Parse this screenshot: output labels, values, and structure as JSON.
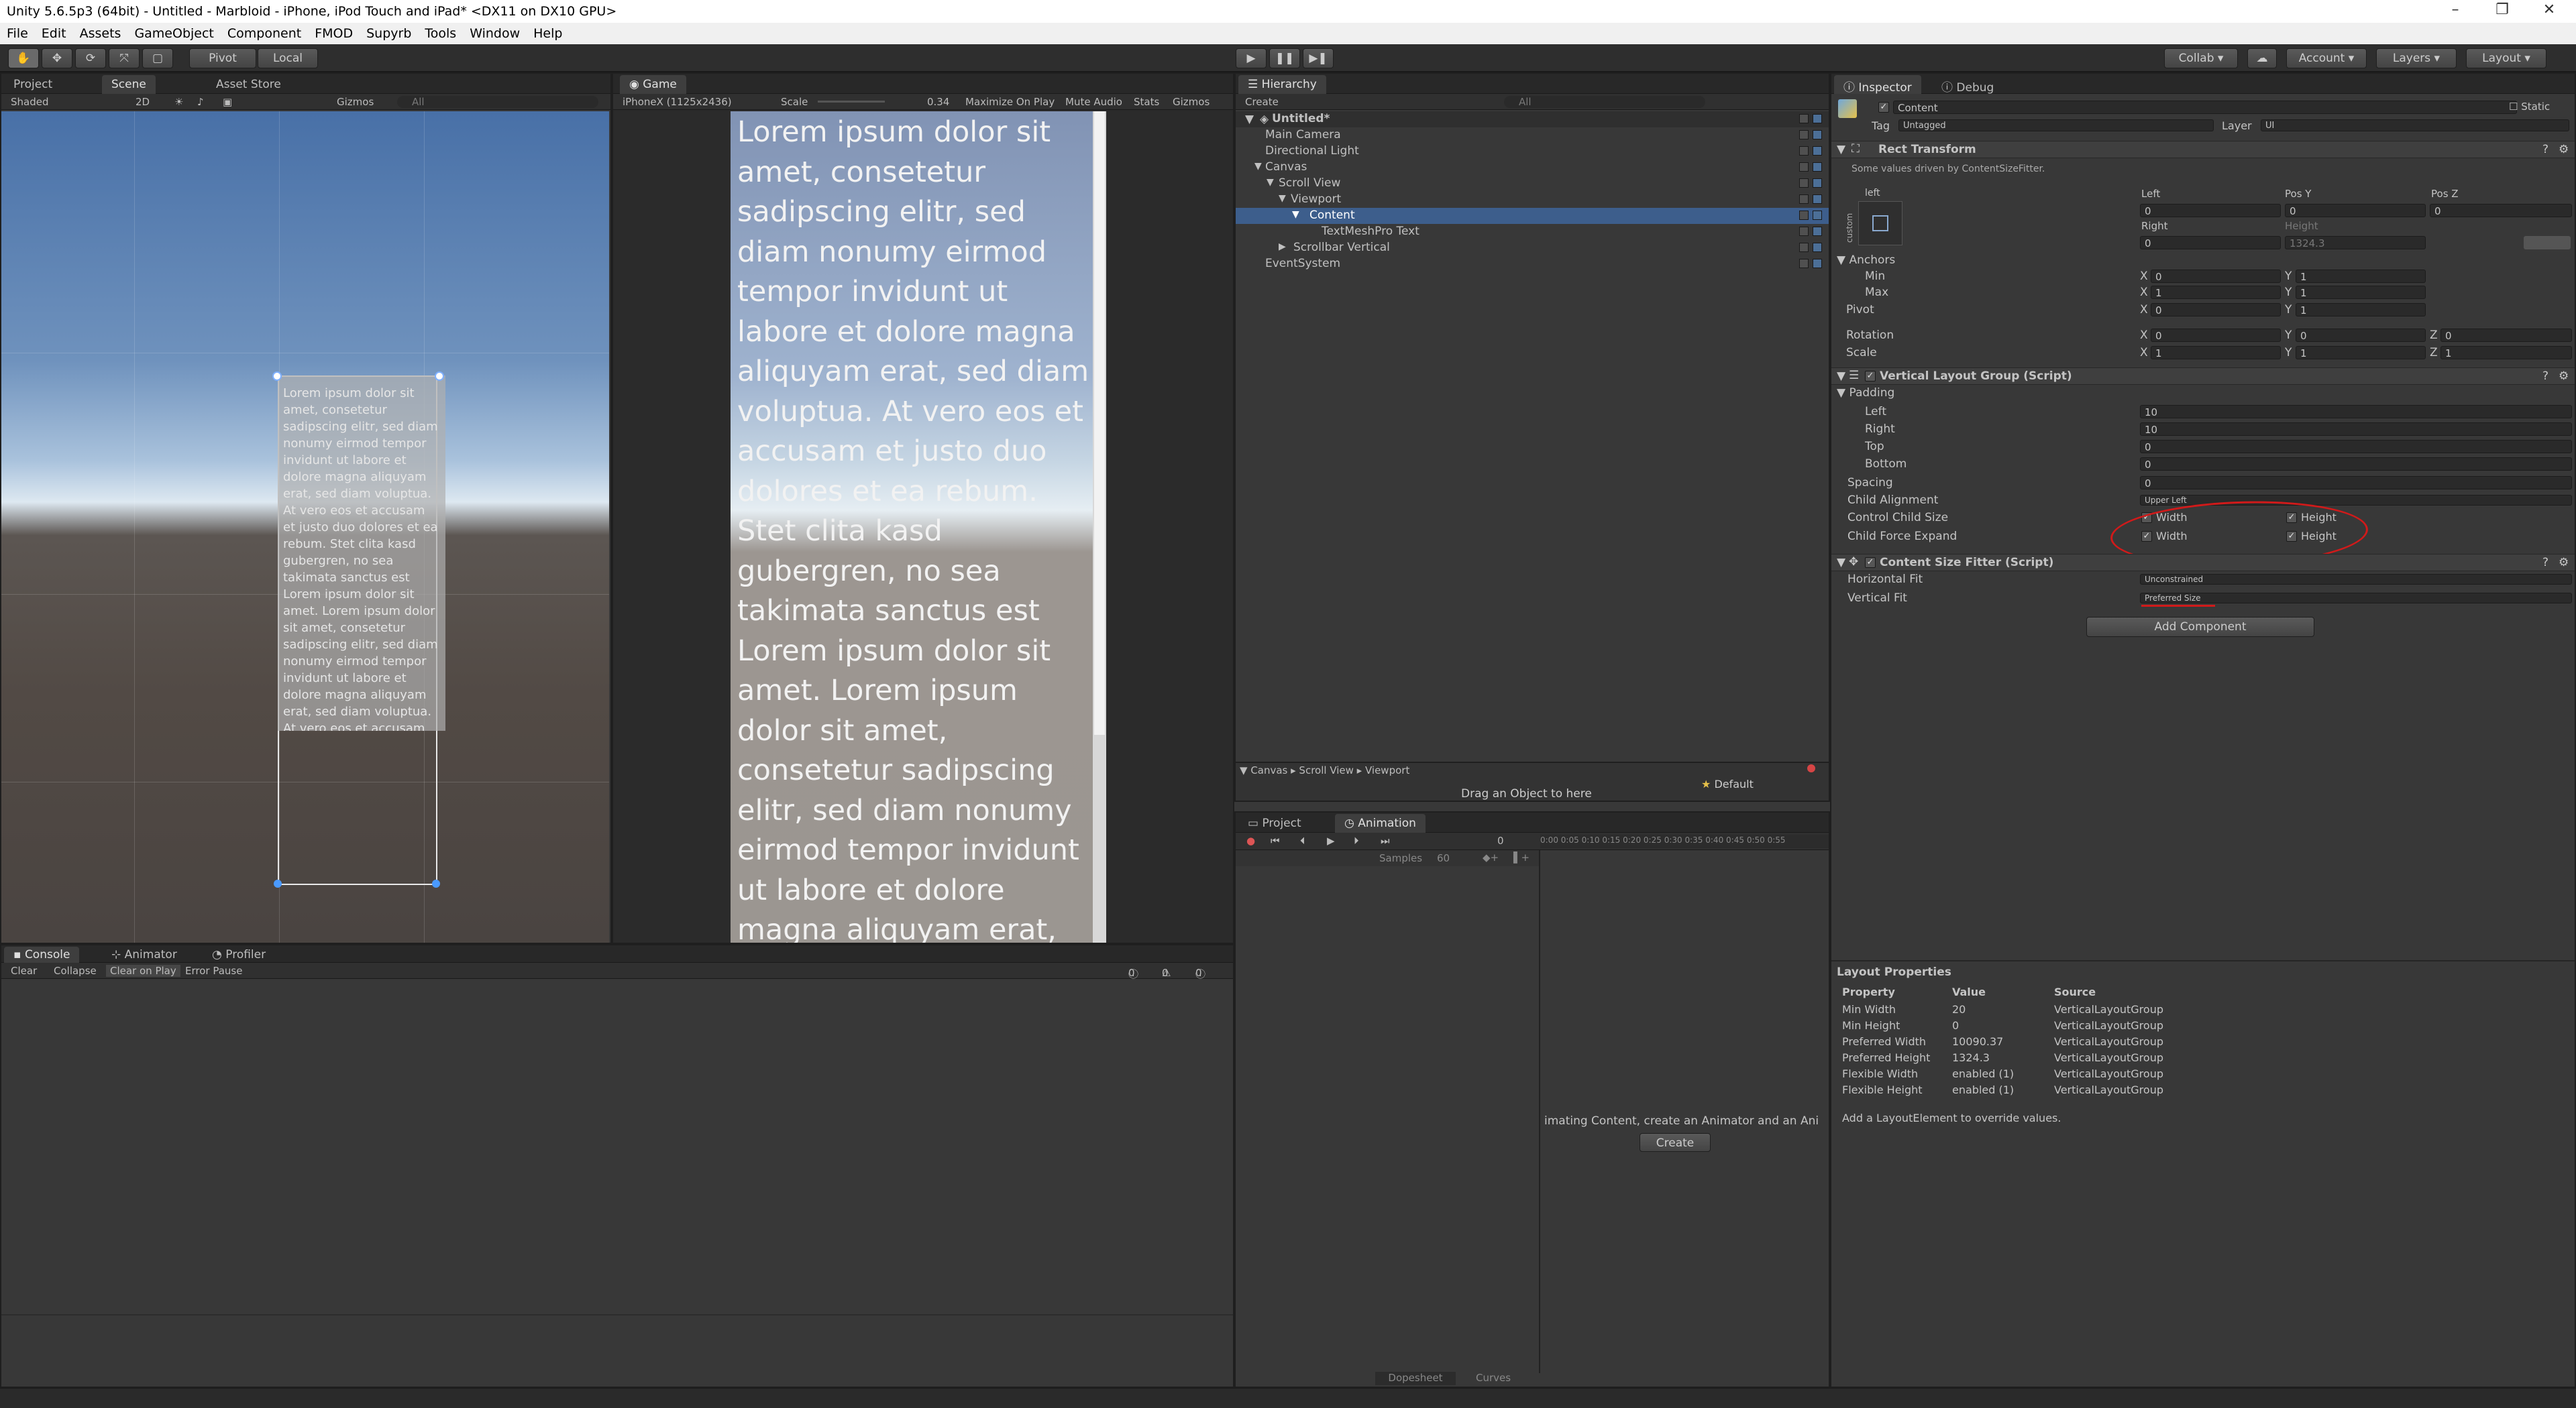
{
  "window": {
    "title": "Unity 5.6.5p3 (64bit) - Untitled - Marbloid - iPhone, iPod Touch and iPad* <DX11 on DX10 GPU>"
  },
  "menu": [
    "File",
    "Edit",
    "Assets",
    "GameObject",
    "Component",
    "FMOD",
    "Supyrb",
    "Tools",
    "Window",
    "Help"
  ],
  "toolbar": {
    "pivot": "Pivot",
    "local": "Local",
    "collab": "Collab",
    "account": "Account",
    "layers": "Layers",
    "layout": "Layout"
  },
  "scene": {
    "tabs": {
      "project": "Project",
      "scene": "Scene",
      "asset_store": "Asset Store"
    },
    "shading": "Shaded",
    "mode_2d": "2D",
    "gizmos": "Gizmos",
    "search_placeholder": "All",
    "text": "Lorem ipsum dolor sit amet, consetetur sadipscing elitr, sed diam nonumy eirmod tempor invidunt ut labore et dolore magna aliquyam erat, sed diam voluptua. At vero eos et accusam et justo duo dolores et ea rebum. Stet clita kasd gubergren, no sea takimata sanctus est Lorem ipsum dolor sit amet. Lorem ipsum dolor sit amet, consetetur sadipscing elitr, sed diam nonumy eirmod tempor invidunt ut labore et dolore magna aliquyam erat, sed diam voluptua. At vero eos et accusam et"
  },
  "game": {
    "tab": "Game",
    "resolution": "iPhoneX (1125x2436)",
    "scale_label": "Scale",
    "scale_value": "0.34",
    "maximize": "Maximize On Play",
    "mute": "Mute Audio",
    "stats": "Stats",
    "gizmos": "Gizmos",
    "text": "Lorem ipsum dolor sit amet, consetetur sadipscing elitr, sed diam nonumy eirmod tempor invidunt ut labore et dolore magna aliquyam erat, sed diam voluptua. At vero eos et accusam et justo duo dolores et ea rebum. Stet clita kasd gubergren, no sea takimata sanctus est Lorem ipsum dolor sit amet. Lorem ipsum dolor sit amet, consetetur sadipscing elitr, sed diam nonumy eirmod tempor invidunt ut labore et dolore magna aliquyam erat, sed diam voluptua. At vero eos et accusam et"
  },
  "hierarchy": {
    "tab": "Hierarchy",
    "create": "Create",
    "search_placeholder": "All",
    "scene_name": "Untitled*",
    "items": [
      "Main Camera",
      "Directional Light",
      "Canvas",
      "Scroll View",
      "Viewport",
      "Content",
      "TextMeshPro Text",
      "Scrollbar Vertical",
      "EventSystem"
    ]
  },
  "animation": {
    "breadcrumb": "Canvas ▸ Scroll View ▸ Viewport",
    "drag_hint": "Drag an Object to here",
    "default": "Default",
    "tabs": {
      "project": "Project",
      "animation": "Animation"
    },
    "samples_label": "Samples",
    "samples_value": "60",
    "frame": "0",
    "ticks": [
      "0:00",
      "0:05",
      "0:10",
      "0:15",
      "0:20",
      "0:25",
      "0:30",
      "0:35",
      "0:40",
      "0:45",
      "0:50",
      "0:55"
    ],
    "message": "imating Content, create an Animator and an Ani",
    "create": "Create",
    "dopesheet": "Dopesheet",
    "curves": "Curves"
  },
  "console": {
    "tabs": {
      "console": "Console",
      "animator": "Animator",
      "profiler": "Profiler"
    },
    "buttons": [
      "Clear",
      "Collapse",
      "Clear on Play",
      "Error Pause"
    ],
    "counts": [
      "0",
      "0",
      "0"
    ]
  },
  "inspector": {
    "tabs": {
      "inspector": "Inspector",
      "debug": "Debug"
    },
    "object_name": "Content",
    "static": "Static",
    "tag_label": "Tag",
    "tag": "Untagged",
    "layer_label": "Layer",
    "layer": "UI",
    "rect": {
      "title": "Rect Transform",
      "note": "Some values driven by ContentSizeFitter.",
      "anchor_label": "left",
      "custom": "custom",
      "col_left": "Left",
      "col_posy": "Pos Y",
      "col_posz": "Pos Z",
      "left": "0",
      "posy": "0",
      "posz": "0",
      "right_label": "Right",
      "height_label": "Height",
      "right": "0",
      "height": "1324.3",
      "anchors": "Anchors",
      "min": "Min",
      "max": "Max",
      "pivot": "Pivot",
      "rotation": "Rotation",
      "scale": "Scale",
      "min_x": "0",
      "min_y": "1",
      "max_x": "1",
      "max_y": "1",
      "pivot_x": "0",
      "pivot_y": "1",
      "rot_x": "0",
      "rot_y": "0",
      "rot_z": "0",
      "scale_x": "1",
      "scale_y": "1",
      "scale_z": "1",
      "x": "X",
      "y": "Y",
      "z": "Z"
    },
    "vlg": {
      "title": "Vertical Layout Group (Script)",
      "padding": "Padding",
      "left": "Left",
      "right": "Right",
      "top": "Top",
      "bottom": "Bottom",
      "left_v": "10",
      "right_v": "10",
      "top_v": "0",
      "bottom_v": "0",
      "spacing": "Spacing",
      "spacing_v": "0",
      "alignment": "Child Alignment",
      "alignment_v": "Upper Left",
      "control": "Control Child Size",
      "expand": "Child Force Expand",
      "width": "Width",
      "height": "Height"
    },
    "csf": {
      "title": "Content Size Fitter (Script)",
      "hfit": "Horizontal Fit",
      "hfit_v": "Unconstrained",
      "vfit": "Vertical Fit",
      "vfit_v": "Preferred Size"
    },
    "add_component": "Add Component"
  },
  "layout_props": {
    "title": "Layout Properties",
    "headers": [
      "Property",
      "Value",
      "Source"
    ],
    "rows": [
      [
        "Min Width",
        "20",
        "VerticalLayoutGroup"
      ],
      [
        "Min Height",
        "0",
        "VerticalLayoutGroup"
      ],
      [
        "Preferred Width",
        "10090.37",
        "VerticalLayoutGroup"
      ],
      [
        "Preferred Height",
        "1324.3",
        "VerticalLayoutGroup"
      ],
      [
        "Flexible Width",
        "enabled (1)",
        "VerticalLayoutGroup"
      ],
      [
        "Flexible Height",
        "enabled (1)",
        "VerticalLayoutGroup"
      ]
    ],
    "note": "Add a LayoutElement to override values."
  },
  "colors": {
    "accent": "#3d5e8c",
    "annotation": "#d11a1a",
    "panel": "#383838"
  }
}
